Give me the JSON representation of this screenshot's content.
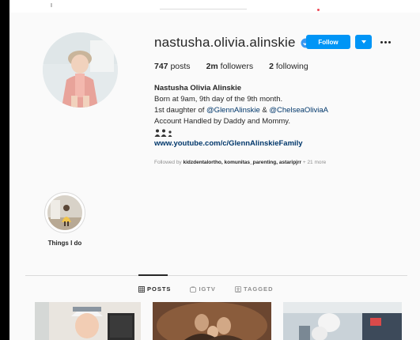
{
  "profile": {
    "username": "nastusha.olivia.alinskie",
    "follow_label": "Follow",
    "stats": {
      "posts_count": "747",
      "posts_label": "posts",
      "followers_count": "2m",
      "followers_label": "followers",
      "following_count": "2",
      "following_label": "following"
    },
    "bio": {
      "full_name": "Nastusha Olivia Alinskie",
      "line1": "Born at 9am, 9th day of the 9th month.",
      "line2_prefix": "1st daughter of ",
      "mention1": "@GlennAlinskie",
      "line2_mid": " & ",
      "mention2": "@ChelseaOliviaA",
      "line3": "Account Handled by Daddy and Mommy.",
      "website": "www.youtube.com/c/GlennAlinskieFamily"
    },
    "followed_by": {
      "prefix": "Followed by ",
      "names": "kidzdentalortho, komunitas_parenting, astaripjrr",
      "suffix": " + 21 more"
    }
  },
  "highlights": [
    {
      "label": "Things I do"
    }
  ],
  "tabs": [
    {
      "label": "POSTS",
      "icon": "grid-icon",
      "active": true
    },
    {
      "label": "IGTV",
      "icon": "igtv-icon",
      "active": false
    },
    {
      "label": "TAGGED",
      "icon": "tagged-icon",
      "active": false
    }
  ],
  "colors": {
    "accent": "#0095f6",
    "link": "#00376b",
    "muted": "#8e8e8e"
  }
}
